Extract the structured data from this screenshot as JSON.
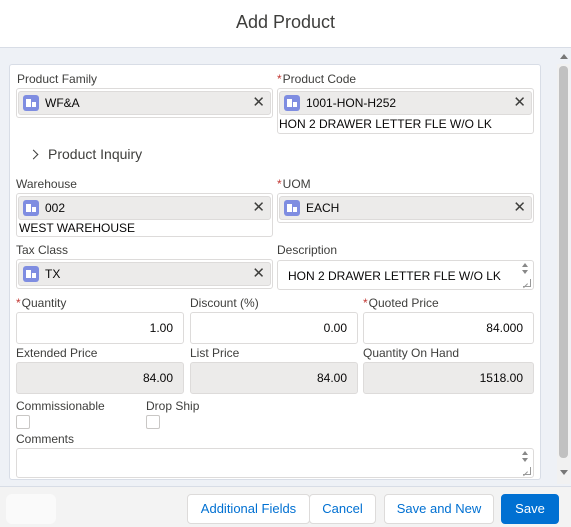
{
  "modal": {
    "title": "Add Product"
  },
  "fields": {
    "product_family": {
      "label": "Product Family",
      "value": "WF&A"
    },
    "product_code": {
      "label": "Product Code",
      "required": "*",
      "value": "1001-HON-H252",
      "description": "HON 2 DRAWER LETTER FLE W/O LK"
    },
    "product_inquiry": {
      "label": "Product Inquiry"
    },
    "warehouse": {
      "label": "Warehouse",
      "value": "002",
      "description": "WEST WAREHOUSE"
    },
    "uom": {
      "label": "UOM",
      "required": "*",
      "value": "EACH"
    },
    "tax_class": {
      "label": "Tax Class",
      "value": "TX"
    },
    "description": {
      "label": "Description",
      "value": "HON 2 DRAWER LETTER FLE W/O LK"
    },
    "quantity": {
      "label": "Quantity",
      "required": "*",
      "value": "1.00"
    },
    "discount": {
      "label": "Discount (%)",
      "value": "0.00"
    },
    "quoted_price": {
      "label": "Quoted Price",
      "required": "*",
      "value": "84.000"
    },
    "extended_price": {
      "label": "Extended Price",
      "value": "84.00"
    },
    "list_price": {
      "label": "List Price",
      "value": "84.00"
    },
    "quantity_on_hand": {
      "label": "Quantity On Hand",
      "value": "1518.00"
    },
    "commissionable": {
      "label": "Commissionable"
    },
    "drop_ship": {
      "label": "Drop Ship"
    },
    "comments": {
      "label": "Comments",
      "value": ""
    }
  },
  "footer": {
    "additional_fields": "Additional Fields",
    "cancel": "Cancel",
    "save_and_new": "Save and New",
    "save": "Save"
  },
  "icons": {
    "lookup": "record-icon",
    "clear": "close-icon"
  },
  "colors": {
    "brand": "#0070d2",
    "required": "#c23934",
    "lookup_icon": "#7f8de1"
  }
}
